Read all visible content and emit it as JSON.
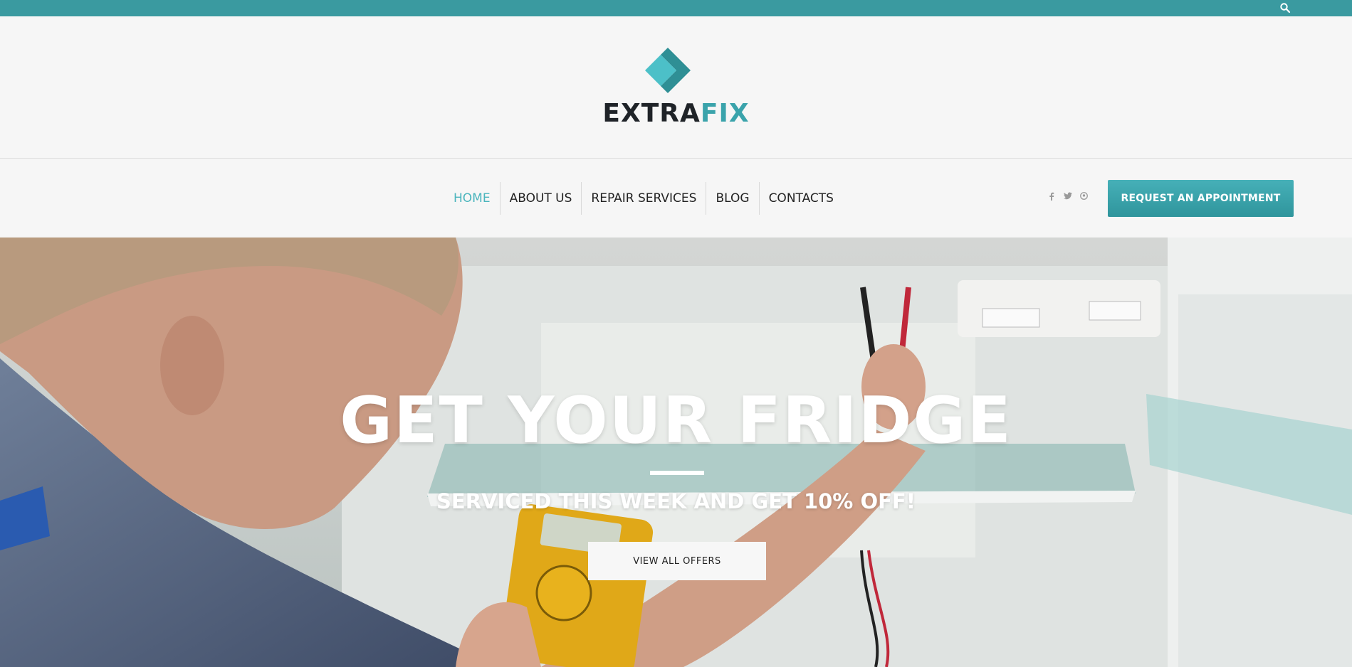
{
  "topbar": {
    "search_icon": "search-icon",
    "color": "#3a9aa0"
  },
  "brand": {
    "part1": "EXTRA",
    "part2": "FIX",
    "accent": "#3aa3ab"
  },
  "nav": {
    "items": [
      {
        "label": "HOME",
        "active": true
      },
      {
        "label": "ABOUT US",
        "active": false
      },
      {
        "label": "REPAIR SERVICES",
        "active": false
      },
      {
        "label": "BLOG",
        "active": false
      },
      {
        "label": "CONTACTS",
        "active": false
      }
    ],
    "social": [
      "facebook-icon",
      "twitter-icon",
      "pinterest-icon"
    ],
    "cta_label": "REQUEST AN APPOINTMENT"
  },
  "hero": {
    "title": "GET YOUR FRIDGE",
    "subtitle": "SERVICED THIS WEEK AND GET 10% OFF!",
    "button_label": "VIEW ALL OFFERS"
  }
}
